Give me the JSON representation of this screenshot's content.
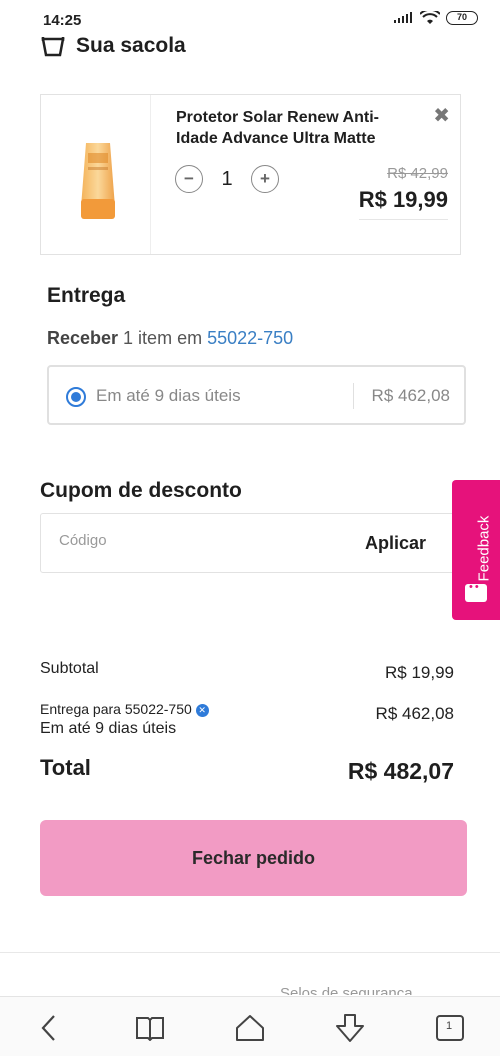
{
  "status": {
    "time": "14:25",
    "battery": "70"
  },
  "header": {
    "title": "Sua sacola"
  },
  "product": {
    "name": "Protetor Solar Renew Anti-Idade Advance Ultra Matte",
    "quantity": "1",
    "old_price": "R$ 42,99",
    "price": "R$ 19,99"
  },
  "delivery": {
    "title": "Entrega",
    "receive_bold": "Receber",
    "receive_text": " 1 item em ",
    "zip": "55022-750",
    "option_label": "Em até 9 dias úteis",
    "option_price": "R$ 462,08"
  },
  "coupon": {
    "title": "Cupom de desconto",
    "placeholder": "Código",
    "apply_label": "Aplicar"
  },
  "feedback": {
    "label": "Feedback"
  },
  "summary": {
    "subtotal_label": "Subtotal",
    "subtotal_value": "R$ 19,99",
    "shipping_label": "Entrega para 55022-750",
    "shipping_sub": "Em até 9 dias úteis",
    "shipping_value": "R$ 462,08",
    "total_label": "Total",
    "total_value": "R$ 482,07"
  },
  "checkout": {
    "label": "Fechar pedido"
  },
  "footer": {
    "security_text": "Selos de segurança"
  },
  "navbar": {
    "tabs_count": "1"
  },
  "colors": {
    "accent_pink": "#f29bc4",
    "feedback_pink": "#e6127b",
    "link_blue": "#3a7fc4"
  }
}
